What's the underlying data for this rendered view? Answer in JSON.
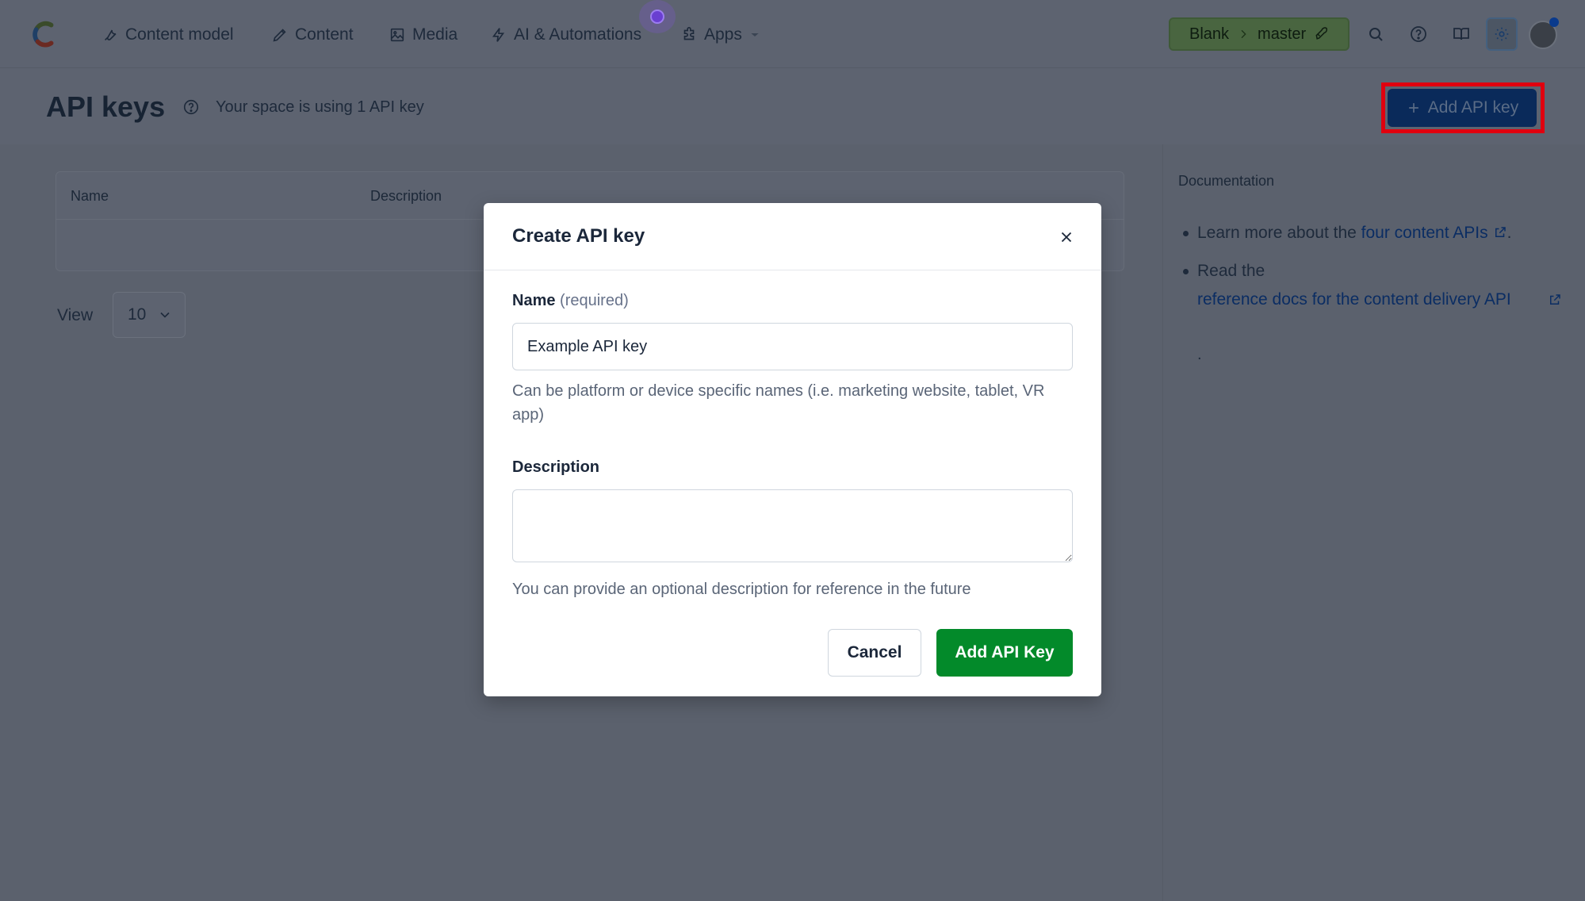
{
  "nav": {
    "items": [
      {
        "label": "Content model",
        "icon": "wrench-icon"
      },
      {
        "label": "Content",
        "icon": "pen-icon"
      },
      {
        "label": "Media",
        "icon": "image-icon"
      },
      {
        "label": "AI & Automations",
        "icon": "lightning-icon"
      },
      {
        "label": "Apps",
        "icon": "puzzle-icon"
      }
    ],
    "space": "Blank",
    "environment": "master"
  },
  "page": {
    "title": "API keys",
    "subtitle": "Your space is using 1 API key",
    "add_button_label": "Add API key"
  },
  "table": {
    "columns": [
      "Name",
      "Description"
    ]
  },
  "pagination": {
    "view_label": "View",
    "page_size": "10"
  },
  "documentation": {
    "title": "Documentation",
    "item1_prefix": "Learn more about the ",
    "item1_link": "four content APIs",
    "item1_suffix": ".",
    "item2_prefix": "Read the",
    "item2_link": "reference docs for the content delivery API",
    "trailing": "."
  },
  "modal": {
    "title": "Create API key",
    "name_label": "Name",
    "name_required": "(required)",
    "name_value": "Example API key",
    "name_hint": "Can be platform or device specific names (i.e. marketing website, tablet, VR app)",
    "description_label": "Description",
    "description_value": "",
    "description_hint": "You can provide an optional description for reference in the future",
    "cancel_label": "Cancel",
    "submit_label": "Add API Key"
  },
  "colors": {
    "primary_green": "#038a2a",
    "primary_blue": "#0a2a5a",
    "highlight_red": "#e0000f"
  }
}
